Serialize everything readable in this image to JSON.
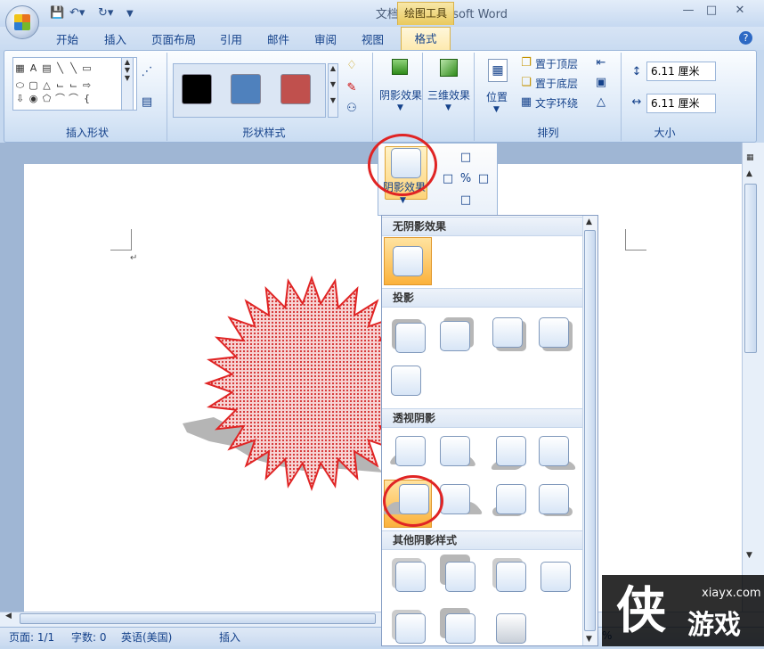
{
  "app": {
    "title": "文档 1 - Microsoft Word",
    "contextual_group": "绘图工具"
  },
  "tabs": [
    "开始",
    "插入",
    "页面布局",
    "引用",
    "邮件",
    "审阅",
    "视图"
  ],
  "active_tab": "格式",
  "ribbon": {
    "groups": {
      "insert_shapes": "插入形状",
      "shape_styles": "形状样式",
      "arrange": "排列",
      "size": "大小"
    },
    "shadow_effects": "阴影效果",
    "threed_effects": "三维效果",
    "position": "位置",
    "bring_to_front": "置于顶层",
    "send_to_back": "置于底层",
    "text_wrapping": "文字环绕",
    "height_value": "6.11 厘米",
    "width_value": "6.11 厘米",
    "style_colors": [
      "#000000",
      "#4f81bd",
      "#c0504d"
    ]
  },
  "popup": {
    "shadow_button": "阴影效果"
  },
  "gallery": {
    "sections": [
      "无阴影效果",
      "投影",
      "透视阴影",
      "其他阴影样式"
    ]
  },
  "status": {
    "page": "页面: 1/1",
    "words": "字数: 0",
    "language": "英语(美国)",
    "mode": "插入",
    "zoom_fragment": "%"
  },
  "watermark": {
    "site": "xiayx.com"
  }
}
